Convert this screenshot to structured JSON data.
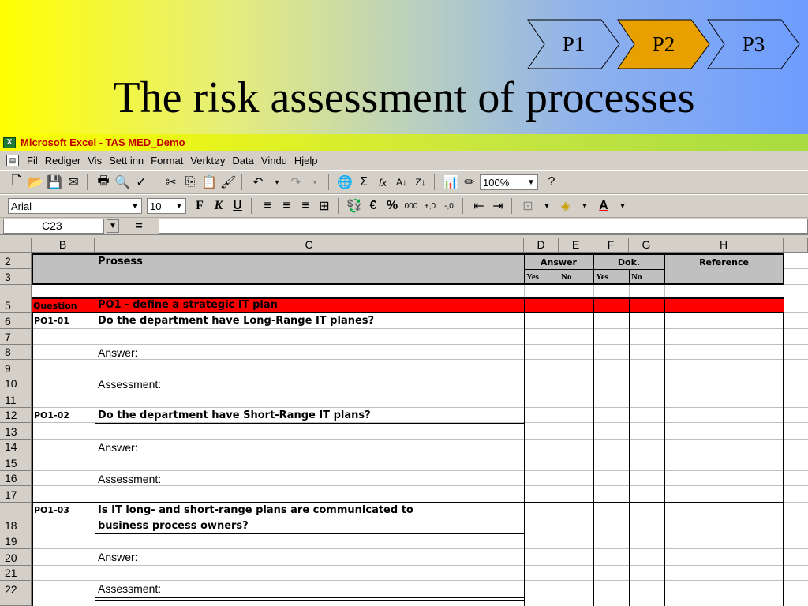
{
  "slide": {
    "title": "The risk assessment of processes",
    "steps": [
      {
        "label": "P1",
        "active": false
      },
      {
        "label": "P2",
        "active": true
      },
      {
        "label": "P3",
        "active": false
      }
    ],
    "active_color": "#e8a000"
  },
  "excel": {
    "window_title": "Microsoft Excel - TAS MED_Demo",
    "menu": [
      "Fil",
      "Rediger",
      "Vis",
      "Sett inn",
      "Format",
      "Verktøy",
      "Data",
      "Vindu",
      "Hjelp"
    ],
    "zoom": "100%",
    "font_name": "Arial",
    "font_size": "10",
    "name_box": "C23",
    "formula_fx": "=",
    "column_headers": [
      "B",
      "C",
      "D",
      "E",
      "F",
      "G",
      "H"
    ],
    "header": {
      "prosess": "Prosess",
      "answer": "Answer",
      "dok": "Dok.",
      "reference": "Reference",
      "yes": "Yes",
      "no": "No"
    },
    "section": {
      "tag": "Question",
      "text": "PO1 - define a strategic IT plan",
      "color": "#ff0000"
    },
    "rows": [
      {
        "num": "2"
      },
      {
        "num": "3"
      },
      {
        "num": "5"
      },
      {
        "num": "6",
        "id": "PO1-01",
        "text": "Do the department have Long-Range IT planes?"
      },
      {
        "num": "7"
      },
      {
        "num": "8",
        "text": "Answer:"
      },
      {
        "num": "9"
      },
      {
        "num": "10",
        "text": "Assessment:"
      },
      {
        "num": "11"
      },
      {
        "num": "12",
        "id": "PO1-02",
        "text": "Do the department have Short-Range IT plans?"
      },
      {
        "num": "13"
      },
      {
        "num": "14",
        "text": "Answer:"
      },
      {
        "num": "15"
      },
      {
        "num": "16",
        "text": "Assessment:"
      },
      {
        "num": "17"
      },
      {
        "num": "18",
        "id": "PO1-03",
        "text": "Is IT long- and short-range plans are communicated to",
        "text2": "business process owners?"
      },
      {
        "num": "19"
      },
      {
        "num": "20",
        "text": "Answer:"
      },
      {
        "num": "21"
      },
      {
        "num": "22",
        "text": "Assessment:"
      }
    ]
  }
}
